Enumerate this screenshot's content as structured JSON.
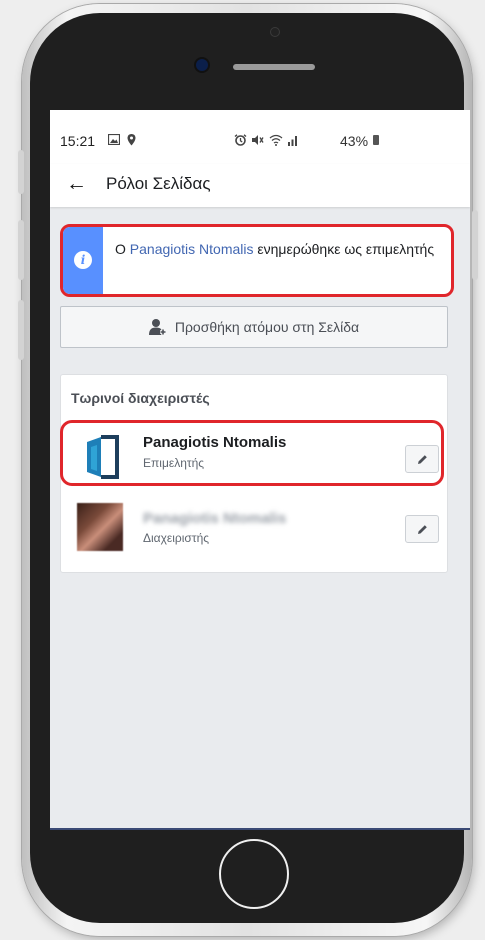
{
  "status_bar": {
    "time": "15:21",
    "battery": "43%",
    "left_icons": [
      "image-icon",
      "location-icon"
    ],
    "right_icons": [
      "alarm-icon",
      "mute-icon",
      "wifi-icon",
      "signal-icon"
    ]
  },
  "header": {
    "back_icon": "arrow-left-icon",
    "title": "Ρόλοι Σελίδας"
  },
  "notice": {
    "icon": "info-icon",
    "prefix": "Ο",
    "name_link": "Panagiotis Ntomalis",
    "suffix": "ενημερώθηκε ως επιμελητής",
    "accent_color": "#5890ff",
    "highlight_color": "#e0262b"
  },
  "add_person": {
    "icon": "add-person-icon",
    "label": "Προσθήκη ατόμου στη Σελίδα"
  },
  "admins": {
    "heading": "Τωρινοί διαχειριστές",
    "items": [
      {
        "name": "Panagiotis Ntomalis",
        "role": "Επιμελητής",
        "avatar": "logo-icon",
        "edit_icon": "pencil-icon"
      },
      {
        "name": "Panagiotis Ntomalis",
        "role": "Διαχειριστής",
        "avatar": "profile-photo",
        "edit_icon": "pencil-icon"
      }
    ]
  }
}
